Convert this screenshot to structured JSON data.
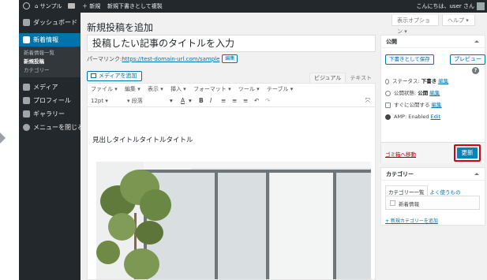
{
  "admin_bar": {
    "site_name": "サンプル",
    "new_label": "＋ 新規",
    "view_label": "新規下書きとして複製",
    "howdy": "こんにちは、user さん"
  },
  "sidebar": {
    "items": [
      {
        "label": "ダッシュボード",
        "icon": "dashboard-icon"
      },
      {
        "label": "新着情報",
        "icon": "pin-icon"
      },
      {
        "label": "メディア",
        "icon": "media-icon"
      },
      {
        "label": "プロフィール",
        "icon": "user-icon"
      },
      {
        "label": "ギャラリー",
        "icon": "pin-icon"
      },
      {
        "label": "メニューを閉じる",
        "icon": "collapse-icon"
      }
    ],
    "submenu": [
      "新着情報一覧",
      "新規投稿",
      "カテゴリー"
    ]
  },
  "header": {
    "screen_options": "表示オプション ▾",
    "help": "ヘルプ ▾",
    "page_title": "新規投稿を追加"
  },
  "post": {
    "title": "投稿したい記事のタイトルを入力",
    "permalink_label": "パーマリンク: ",
    "permalink_url": "https://test-domain-url.com/sample",
    "permalink_edit": "編集"
  },
  "editor": {
    "add_media": "メディアを追加",
    "tab_visual": "ビジュアル",
    "tab_text": "テキスト",
    "menus": [
      "ファイル ▾",
      "編集 ▾",
      "表示 ▾",
      "挿入 ▾",
      "フォーマット ▾",
      "ツール ▾",
      "テーブル ▾"
    ],
    "font_size": "12pt",
    "paragraph": "段落",
    "heading_text": "見出しタイトルタイトルタイトル"
  },
  "publish": {
    "title": "公開",
    "save_draft": "下書きとして保存",
    "preview": "プレビュー",
    "status_label": "ステータス: ",
    "status_value": "下書き",
    "status_edit": "編集",
    "visibility_label": "公開状態: ",
    "visibility_value": "公開",
    "visibility_edit": "編集",
    "schedule_label": "すぐに公開する",
    "schedule_edit": "編集",
    "amp_label": "AMP: Enabled",
    "amp_edit": "Edit",
    "trash": "ゴミ箱へ移動",
    "update": "更新",
    "highlight_color": "#d0021b"
  },
  "category": {
    "title": "カテゴリー",
    "tab_all": "カテゴリー一覧",
    "tab_popular": "よく使うもの",
    "item": "新着情報",
    "add_new": "+ 新規カテゴリーを追加"
  }
}
